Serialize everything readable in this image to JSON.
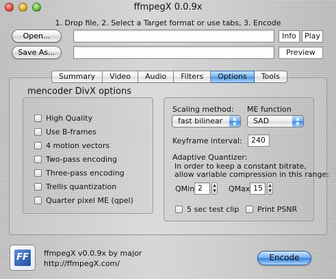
{
  "window": {
    "title": "ffmpegX 0.0.9x",
    "instructions": "1. Drop file, 2. Select a Target format or use tabs, 3. Encode"
  },
  "files": {
    "open_label": "Open...",
    "open_value": "",
    "save_as_label": "Save As...",
    "save_value": "",
    "info_label": "Info",
    "play_label": "Play",
    "preview_label": "Preview"
  },
  "tabs": [
    {
      "label": "Summary",
      "active": false
    },
    {
      "label": "Video",
      "active": false
    },
    {
      "label": "Audio",
      "active": false
    },
    {
      "label": "Filters",
      "active": false
    },
    {
      "label": "Options",
      "active": true
    },
    {
      "label": "Tools",
      "active": false
    }
  ],
  "options": {
    "panel_title": "mencoder DivX options",
    "checkboxes": [
      {
        "label": "High Quality",
        "checked": false
      },
      {
        "label": "Use B-frames",
        "checked": false
      },
      {
        "label": "4 motion vectors",
        "checked": false
      },
      {
        "label": "Two-pass encoding",
        "checked": false
      },
      {
        "label": "Three-pass encoding",
        "checked": false
      },
      {
        "label": "Trellis quantization",
        "checked": false
      },
      {
        "label": "Quarter pixel ME (qpel)",
        "checked": false
      }
    ],
    "scaling_method_label": "Scaling method:",
    "scaling_method_value": "fast bilinear",
    "me_function_label": "ME function",
    "me_function_value": "SAD",
    "keyframe_label": "Keyframe interval:",
    "keyframe_value": "240",
    "aq_title": "Adaptive Quantizer:",
    "aq_desc_1": "In order to keep a constant bitrate,",
    "aq_desc_2": "allow variable compression in this range:",
    "qmin_label": "QMin",
    "qmin_value": "2",
    "qmax_label": "QMax",
    "qmax_value": "15",
    "test_clip_label": "5 sec test clip",
    "print_psnr_label": "Print PSNR"
  },
  "footer": {
    "icon_glyph": "FF",
    "credit_line_1": "ffmpegX v0.0.9x by major",
    "credit_line_2": "http://ffmpegX.com/",
    "encode_label": "Encode"
  },
  "colors": {
    "accent": "#4f93e0",
    "brushed_metal": "#cbcbcb"
  }
}
